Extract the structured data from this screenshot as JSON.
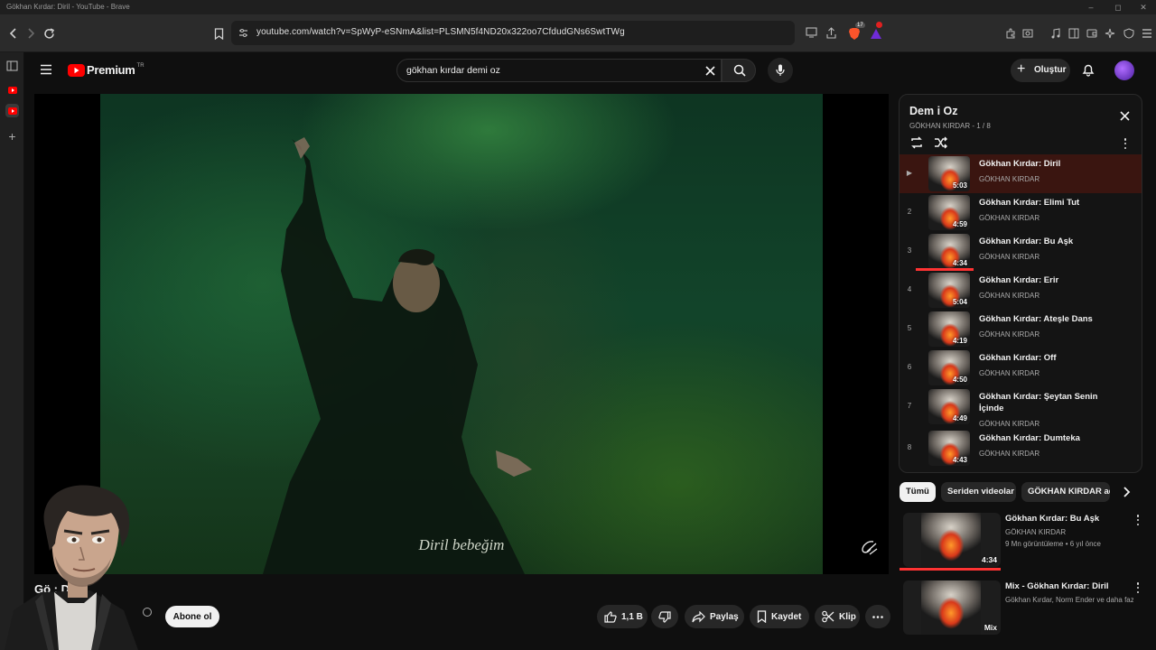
{
  "window": {
    "title": "Gökhan Kırdar: Diril - YouTube - Brave"
  },
  "browser": {
    "url": "youtube.com/watch?v=SpWyP-eSNmA&list=PLSMN5f4ND20x322oo7CfdudGNs6SwtTWg",
    "brave_badge": "17"
  },
  "youtube": {
    "logo_text": "Premium",
    "region": "TR",
    "search_value": "gökhan kırdar demi oz",
    "create_label": "Oluştur"
  },
  "video": {
    "subtitle_text": "Diril bebeğim",
    "title": "Gö          : Diril",
    "subscribe_label": "Abone ol",
    "likes": "1,1 B",
    "share_label": "Paylaş",
    "save_label": "Kaydet",
    "clip_label": "Klip"
  },
  "playlist": {
    "title": "Dem i Oz",
    "subtitle": "GÖKHAN KIRDAR - 1 / 8",
    "items": [
      {
        "index": "▶",
        "title": "Gökhan Kırdar: Diril",
        "channel": "GÖKHAN KIRDAR",
        "duration": "5:03"
      },
      {
        "index": "2",
        "title": "Gökhan Kırdar: Elimi Tut",
        "channel": "GÖKHAN KIRDAR",
        "duration": "4:59"
      },
      {
        "index": "3",
        "title": "Gökhan Kırdar: Bu Aşk",
        "channel": "GÖKHAN KIRDAR",
        "duration": "4:34"
      },
      {
        "index": "4",
        "title": "Gökhan Kırdar: Erir",
        "channel": "GÖKHAN KIRDAR",
        "duration": "5:04"
      },
      {
        "index": "5",
        "title": "Gökhan Kırdar: Ateşle Dans",
        "channel": "GÖKHAN KIRDAR",
        "duration": "4:19"
      },
      {
        "index": "6",
        "title": "Gökhan Kırdar: Off",
        "channel": "GÖKHAN KIRDAR",
        "duration": "4:50"
      },
      {
        "index": "7",
        "title": "Gökhan Kırdar: Şeytan Senin İçinde",
        "channel": "GÖKHAN KIRDAR",
        "duration": "4:49"
      },
      {
        "index": "8",
        "title": "Gökhan Kırdar: Dumteka",
        "channel": "GÖKHAN KIRDAR",
        "duration": "4:43"
      }
    ]
  },
  "chips": [
    "Tümü",
    "Seriden videolar",
    "GÖKHAN KIRDAR adlı"
  ],
  "recommendations": [
    {
      "title": "Gökhan Kırdar: Bu Aşk",
      "channel": "GÖKHAN KIRDAR",
      "meta": "9 Mn görüntüleme • 6 yıl önce",
      "duration": "4:34"
    },
    {
      "title": "Mix - Gökhan Kırdar: Diril",
      "channel": "Gökhan Kırdar, Norm Ender ve daha fazlası",
      "meta": "",
      "duration": "Mix"
    }
  ],
  "colors": {
    "accent": "#ff0000",
    "active_row": "#3a1510",
    "progress": "#ff3333"
  }
}
